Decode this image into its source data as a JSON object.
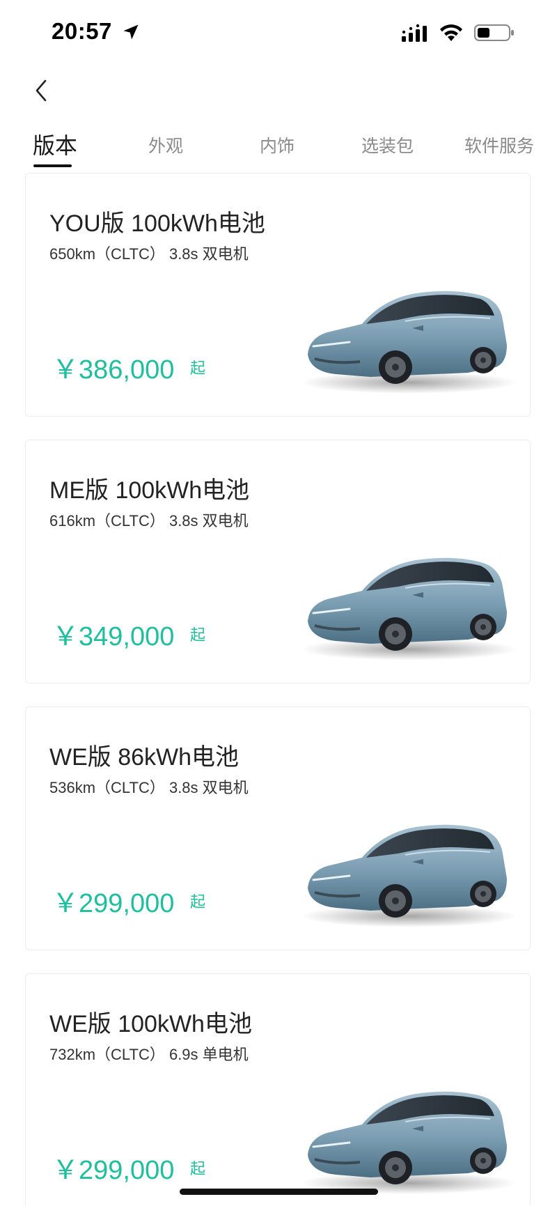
{
  "status": {
    "time": "20:57"
  },
  "tabs": [
    {
      "label": "版本",
      "active": true
    },
    {
      "label": "外观",
      "active": false
    },
    {
      "label": "内饰",
      "active": false
    },
    {
      "label": "选装包",
      "active": false
    },
    {
      "label": "软件服务",
      "active": false
    }
  ],
  "versions": [
    {
      "title": "YOU版 100kWh电池",
      "spec": "650km（CLTC） 3.8s 双电机",
      "price": "￥386,000",
      "price_suffix": "起"
    },
    {
      "title": "ME版 100kWh电池",
      "spec": "616km（CLTC） 3.8s 双电机",
      "price": "￥349,000",
      "price_suffix": "起"
    },
    {
      "title": "WE版 86kWh电池",
      "spec": "536km（CLTC） 3.8s 双电机",
      "price": "￥299,000",
      "price_suffix": "起"
    },
    {
      "title": "WE版 100kWh电池",
      "spec": "732km（CLTC） 6.9s 单电机",
      "price": "￥299,000",
      "price_suffix": "起"
    }
  ],
  "colors": {
    "accent": "#1fbf9d",
    "text": "#222222",
    "tab_inactive": "#8a8a8a",
    "car_body": "#7a9cb1"
  },
  "icons": {
    "back": "chevron-left-icon",
    "location": "location-arrow-icon",
    "signal": "cellular-signal-icon",
    "wifi": "wifi-icon",
    "battery": "battery-icon",
    "car": "car-image"
  }
}
